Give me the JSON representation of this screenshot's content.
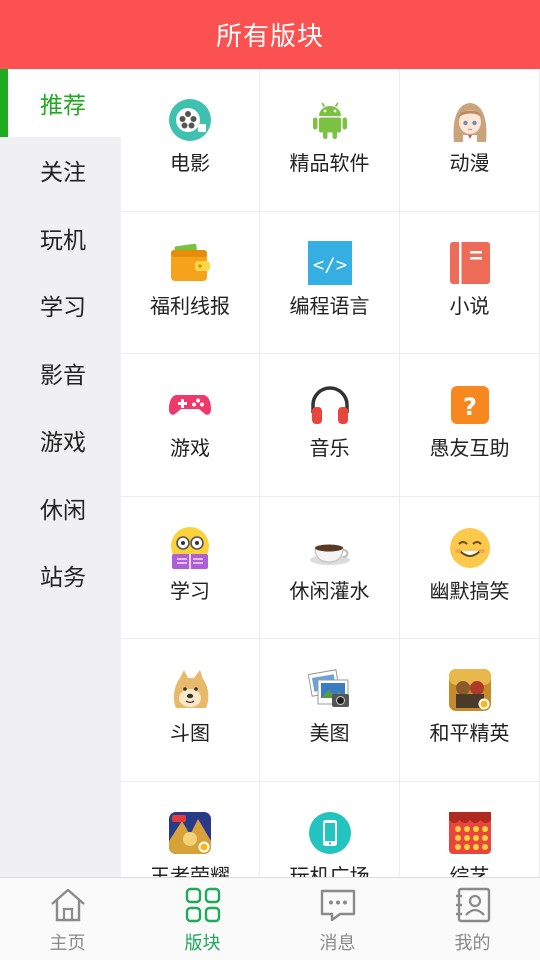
{
  "header": {
    "title": "所有版块"
  },
  "sidebar": {
    "items": [
      {
        "label": "推荐",
        "active": true
      },
      {
        "label": "关注"
      },
      {
        "label": "玩机"
      },
      {
        "label": "学习"
      },
      {
        "label": "影音"
      },
      {
        "label": "游戏"
      },
      {
        "label": "休闲"
      },
      {
        "label": "站务"
      }
    ]
  },
  "boards": [
    {
      "label": "电影",
      "icon": "film-reel-icon"
    },
    {
      "label": "精品软件",
      "icon": "android-icon"
    },
    {
      "label": "动漫",
      "icon": "anime-girl-icon"
    },
    {
      "label": "福利线报",
      "icon": "wallet-icon"
    },
    {
      "label": "编程语言",
      "icon": "code-icon"
    },
    {
      "label": "小说",
      "icon": "book-icon"
    },
    {
      "label": "游戏",
      "icon": "gamepad-icon"
    },
    {
      "label": "音乐",
      "icon": "headphones-icon"
    },
    {
      "label": "愚友互助",
      "icon": "question-icon"
    },
    {
      "label": "学习",
      "icon": "study-face-icon"
    },
    {
      "label": "休闲灌水",
      "icon": "coffee-cup-icon"
    },
    {
      "label": "幽默搞笑",
      "icon": "smile-face-icon"
    },
    {
      "label": "斗图",
      "icon": "doge-icon"
    },
    {
      "label": "美图",
      "icon": "photos-icon"
    },
    {
      "label": "和平精英",
      "icon": "peace-elite-game-icon"
    },
    {
      "label": "王者荣耀",
      "icon": "honor-of-kings-icon"
    },
    {
      "label": "玩机广场",
      "icon": "phone-icon"
    },
    {
      "label": "综艺",
      "icon": "variety-stage-icon"
    }
  ],
  "tabbar": {
    "items": [
      {
        "label": "主页",
        "icon": "home-icon"
      },
      {
        "label": "版块",
        "icon": "grid-icon",
        "active": true
      },
      {
        "label": "消息",
        "icon": "message-icon"
      },
      {
        "label": "我的",
        "icon": "profile-icon"
      }
    ]
  },
  "colors": {
    "header": "#fb5150",
    "accent_green": "#1faa1f",
    "tab_active": "#1faa5a"
  }
}
